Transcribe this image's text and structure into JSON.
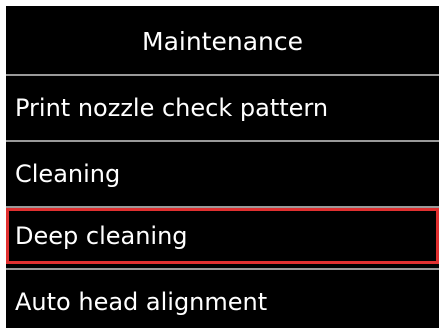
{
  "screen": {
    "title": "Maintenance",
    "menu_items": [
      {
        "label": "Print nozzle check pattern"
      },
      {
        "label": "Cleaning"
      },
      {
        "label": "Deep cleaning",
        "selected": true
      },
      {
        "label": "Auto head alignment"
      }
    ],
    "colors": {
      "background": "#000000",
      "text": "#ffffff",
      "divider": "#9a9a9a",
      "selection_border": "#e03030"
    }
  }
}
